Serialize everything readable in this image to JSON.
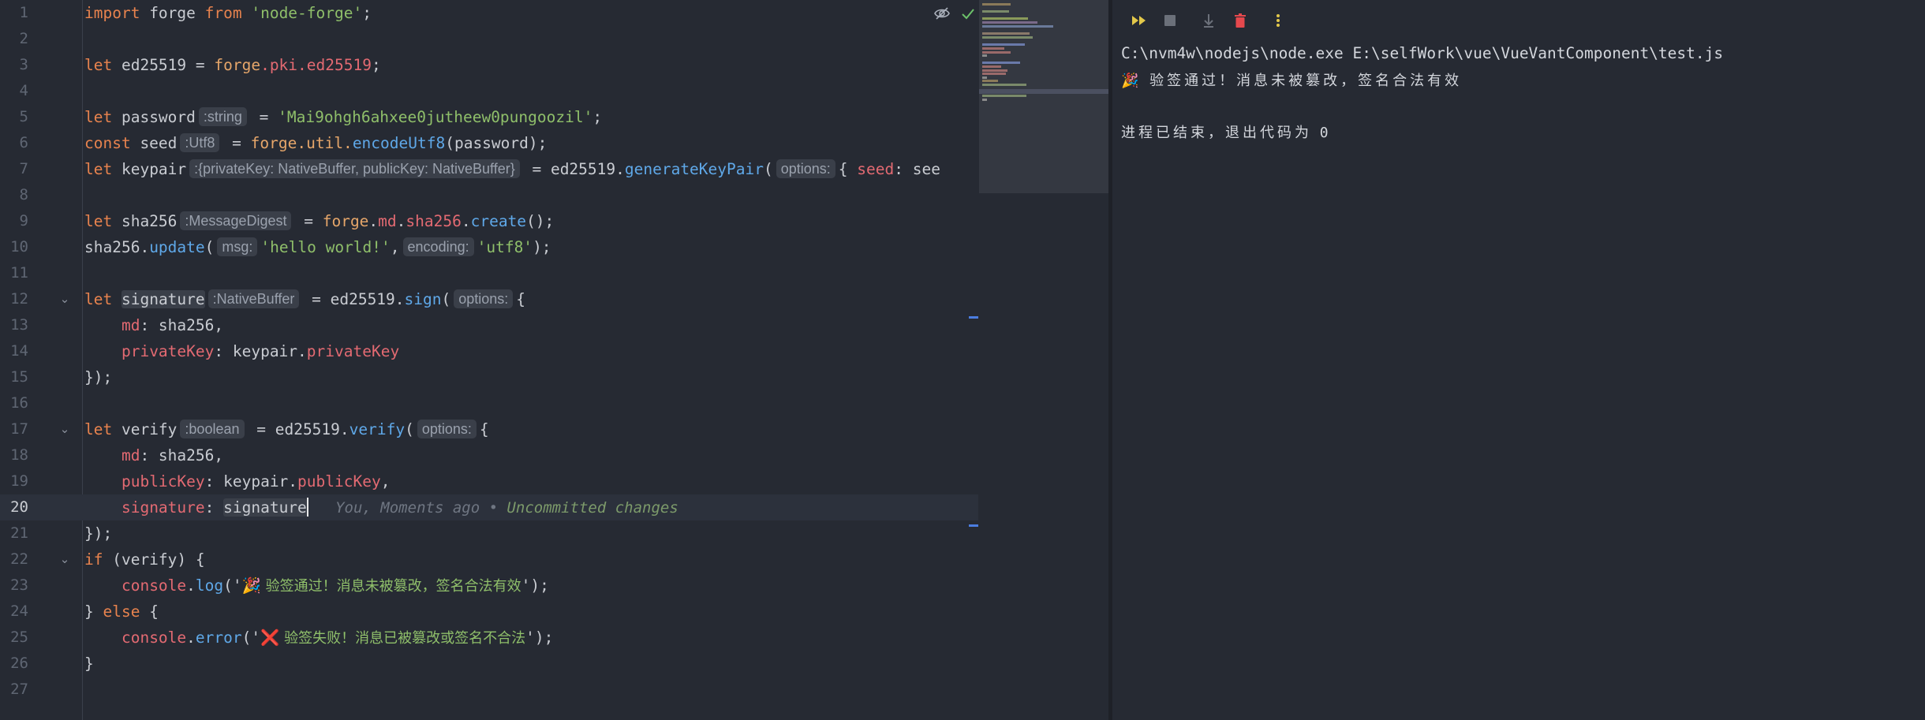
{
  "editor": {
    "lines": [
      {
        "n": "1"
      },
      {
        "n": "2"
      },
      {
        "n": "3"
      },
      {
        "n": "4"
      },
      {
        "n": "5"
      },
      {
        "n": "6"
      },
      {
        "n": "7"
      },
      {
        "n": "8"
      },
      {
        "n": "9"
      },
      {
        "n": "10"
      },
      {
        "n": "11"
      },
      {
        "n": "12"
      },
      {
        "n": "13"
      },
      {
        "n": "14"
      },
      {
        "n": "15"
      },
      {
        "n": "16"
      },
      {
        "n": "17"
      },
      {
        "n": "18"
      },
      {
        "n": "19"
      },
      {
        "n": "20"
      },
      {
        "n": "21"
      },
      {
        "n": "22"
      },
      {
        "n": "23"
      },
      {
        "n": "24"
      },
      {
        "n": "25"
      },
      {
        "n": "26"
      },
      {
        "n": "27"
      }
    ],
    "current_line": "20",
    "code": {
      "l1_import": "import",
      "l1_forge": " forge ",
      "l1_from": "from",
      "l1_str": " 'node-forge'",
      "l1_end": ";",
      "l3_let": "let",
      "l3_rest": " ed25519 = ",
      "l3_forge": "forge",
      "l3_pki": ".pki.ed25519",
      "l3_end": ";",
      "l5_let": "let",
      "l5_name": " password",
      "l5_hint": ":string",
      "l5_eq": " = ",
      "l5_str": "'Mai9ohgh6ahxee0jutheew0pungoozil'",
      "l5_end": ";",
      "l6_const": "const",
      "l6_name": " seed",
      "l6_hint": ":Utf8",
      "l6_eq": " = ",
      "l6_forge": "forge",
      "l6_util": ".util.",
      "l6_fn": "encodeUtf8",
      "l6_end": "(password);",
      "l7_let": "let",
      "l7_name": " keypair",
      "l7_hint": ":{privateKey: NativeBuffer, publicKey: NativeBuffer}",
      "l7_eq": " = ed25519.",
      "l7_fn": "generateKeyPair",
      "l7_paren": "(",
      "l7_hint2": "options:",
      "l7_brace": "{ ",
      "l7_seed": "seed",
      "l7_rest": ": see",
      "l9_let": "let",
      "l9_name": " sha256",
      "l9_hint": ":MessageDigest",
      "l9_eq": " = ",
      "l9_forge": "forge",
      "l9_dot": ".",
      "l9_md": "md",
      "l9_dot2": ".",
      "l9_sha": "sha256",
      "l9_dot3": ".",
      "l9_fn": "create",
      "l9_end": "();",
      "l10_obj": "sha256.",
      "l10_fn": "update",
      "l10_paren": "(",
      "l10_hint": "msg:",
      "l10_str": "'hello world!'",
      "l10_comma": ",",
      "l10_hint2": "encoding:",
      "l10_str2": "'utf8'",
      "l10_end": ");",
      "l12_let": "let",
      "l12_sp": " ",
      "l12_name": "signature",
      "l12_hint": ":NativeBuffer",
      "l12_eq": " = ed25519.",
      "l12_fn": "sign",
      "l12_paren": "(",
      "l12_hint2": "options:",
      "l12_brace": "{",
      "l13_ind": "    ",
      "l13_key": "md",
      "l13_val": ": sha256,",
      "l14_ind": "    ",
      "l14_key": "privateKey",
      "l14_val": ": keypair.",
      "l14_prop": "privateKey",
      "l15": "});",
      "l17_let": "let",
      "l17_name": " verify",
      "l17_hint": ":boolean",
      "l17_eq": " = ed25519.",
      "l17_fn": "verify",
      "l17_paren": "(",
      "l17_hint2": "options:",
      "l17_brace": "{",
      "l18_ind": "    ",
      "l18_key": "md",
      "l18_val": ": sha256,",
      "l19_ind": "    ",
      "l19_key": "publicKey",
      "l19_val": ": keypair.",
      "l19_prop": "publicKey",
      "l19_end": ",",
      "l20_ind": "    ",
      "l20_key": "signature",
      "l20_colon": ": ",
      "l20_val": "signature",
      "l20_blame_you": "   You, Moments ago • ",
      "l20_blame_uc": "Uncommitted changes",
      "l21": "});",
      "l22_if": "if",
      "l22_rest": " (verify) {",
      "l23_ind": "    ",
      "l23_console": "console",
      "l23_dot": ".",
      "l23_fn": "log",
      "l23_open": "('",
      "l23_emoji": "🎉",
      "l23_msg": " 验签通过！消息未被篡改，签名合法有效",
      "l23_close": "');",
      "l24_close": "} ",
      "l24_else": "else",
      "l24_brace": " {",
      "l25_ind": "    ",
      "l25_console": "console",
      "l25_dot": ".",
      "l25_fn": "error",
      "l25_open": "('",
      "l25_emoji": "❌",
      "l25_msg": " 验签失败！消息已被篡改或签名不合法",
      "l25_close": "');",
      "l26": "}"
    }
  },
  "console": {
    "command": "C:\\nvm4w\\nodejs\\node.exe E:\\selfWork\\vue\\VueVantComponent\\test.js",
    "output_emoji": "🎉",
    "output_msg": " 验签通过！消息未被篡改，签名合法有效",
    "exit_msg": "进程已结束，退出代码为 ",
    "exit_code": "0"
  },
  "colors": {
    "background": "#262a33",
    "keyword": "#e8834e",
    "string": "#8fbf6a",
    "function": "#5fa8e8",
    "property": "#e36a72",
    "stop_red": "#e5484d",
    "rerun_yellow": "#e3c84a"
  },
  "icons": {
    "reader_mode": "eye-slash-icon",
    "inspections_ok": "checkmark-icon",
    "rerun": "rerun-icon",
    "stop": "stop-icon",
    "scroll_end": "scroll-to-end-icon",
    "clear": "trash-icon",
    "more": "more-vertical-icon"
  }
}
